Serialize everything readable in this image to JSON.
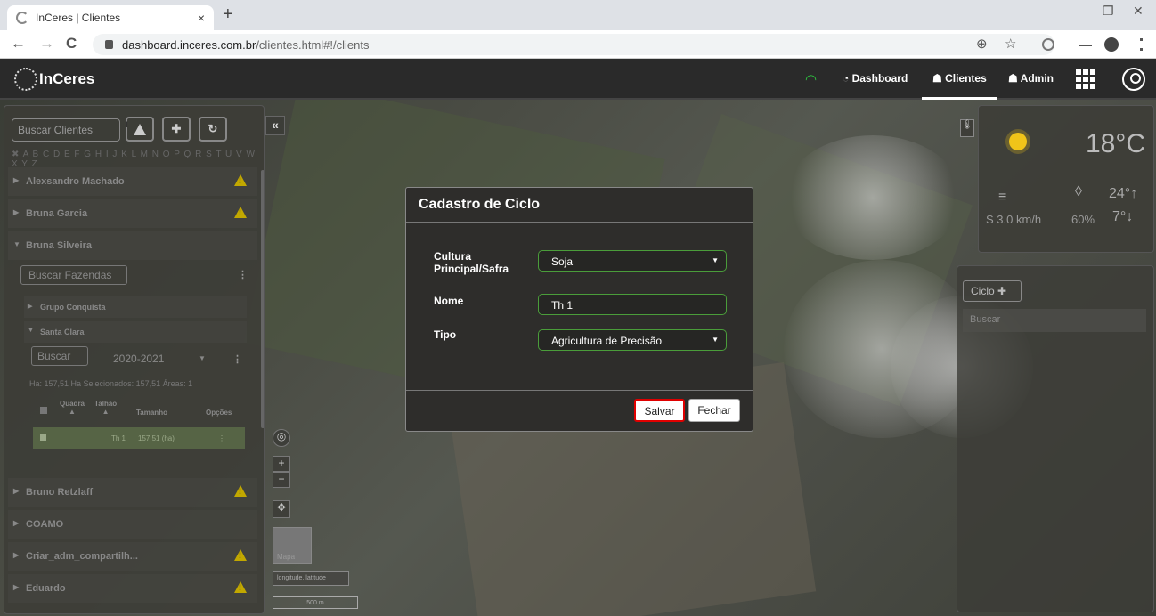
{
  "browser": {
    "tab_title": "InCeres | Clientes",
    "tab_close": "×",
    "new_tab": "+",
    "url_host": "dashboard.inceres.com.br",
    "url_path": "/clientes.html#!/clients",
    "win_min": "–",
    "win_max": "❐",
    "win_close": "✕",
    "nav_back": "←",
    "nav_forward": "→",
    "nav_reload": "C",
    "zoom_glyph": "⊕",
    "star_glyph": "☆"
  },
  "app": {
    "brand": "InCeres",
    "nav": {
      "dashboard": "Dashboard",
      "clientes": "Clientes",
      "admin": "Admin"
    }
  },
  "left_panel": {
    "search_placeholder": "Buscar Clientes",
    "alphabet": "✖ A B C D E F G H I J K L M N O P Q R S T U V W X Y Z",
    "clients": [
      "Alexsandro Machado",
      "Bruna Garcia",
      "Bruna Silveira",
      "Bruno Retzlaff",
      "COAMO",
      "Criar_adm_compartilh...",
      "Eduardo"
    ],
    "farm_search": "Buscar Fazendas",
    "farms": [
      "Grupo Conquista",
      "Santa Clara"
    ],
    "field_search": "Buscar",
    "season": "2020-2021",
    "stats": "Ha: 157,51   Ha Selecionados: 157,51   Áreas: 1",
    "columns": [
      "Quadra",
      "Talhão",
      "Tamanho",
      "Opções"
    ],
    "row": {
      "talhao": "Th 1",
      "tamanho": "157,51 (ha)"
    }
  },
  "map": {
    "coords": "longitude, latitude",
    "scale": "500 m",
    "thumb_label": "Mapa"
  },
  "weather": {
    "temp": "18°C",
    "wind": "S 3.0 km/h",
    "humidity": "60%",
    "high": "24°↑",
    "low": "7°↓"
  },
  "cycle_panel": {
    "button": "Ciclo ✚",
    "search": "Buscar"
  },
  "modal": {
    "title": "Cadastro de Ciclo",
    "label_cultura": "Cultura Principal/Safra",
    "value_cultura": "Soja",
    "label_nome": "Nome",
    "value_nome": "Th 1",
    "label_tipo": "Tipo",
    "value_tipo": "Agricultura de Precisão",
    "save": "Salvar",
    "close": "Fechar"
  }
}
